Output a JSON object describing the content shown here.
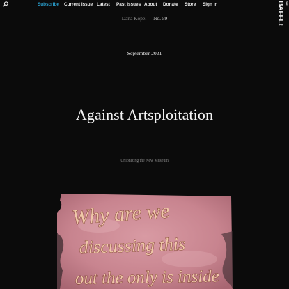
{
  "header": {
    "nav": [
      {
        "label": "Subscribe",
        "accent": true
      },
      {
        "label": "Current Issue"
      },
      {
        "label": "Latest"
      },
      {
        "label": "Past Issues"
      },
      {
        "label": "About"
      },
      {
        "label": "Donate"
      },
      {
        "label": "Store"
      },
      {
        "label": "Sign In"
      }
    ],
    "logo": {
      "small_text": "THE",
      "main_text": "BAFFLER"
    },
    "icons": {
      "search": "search-icon"
    }
  },
  "article": {
    "author": "Dana Kopel",
    "issue": "No. 59",
    "date": "September 2021",
    "title": "Against Artsploitation",
    "subtitle": "Unionizing the New Museum"
  },
  "artwork_text": {
    "line1": "Why are we",
    "line2": "discussing this",
    "line3": "out the only is inside"
  },
  "colors": {
    "background": "#0b0b0b",
    "accent": "#2aa0cf",
    "text": "#f2f2f2",
    "muted": "#8a8a8a"
  }
}
